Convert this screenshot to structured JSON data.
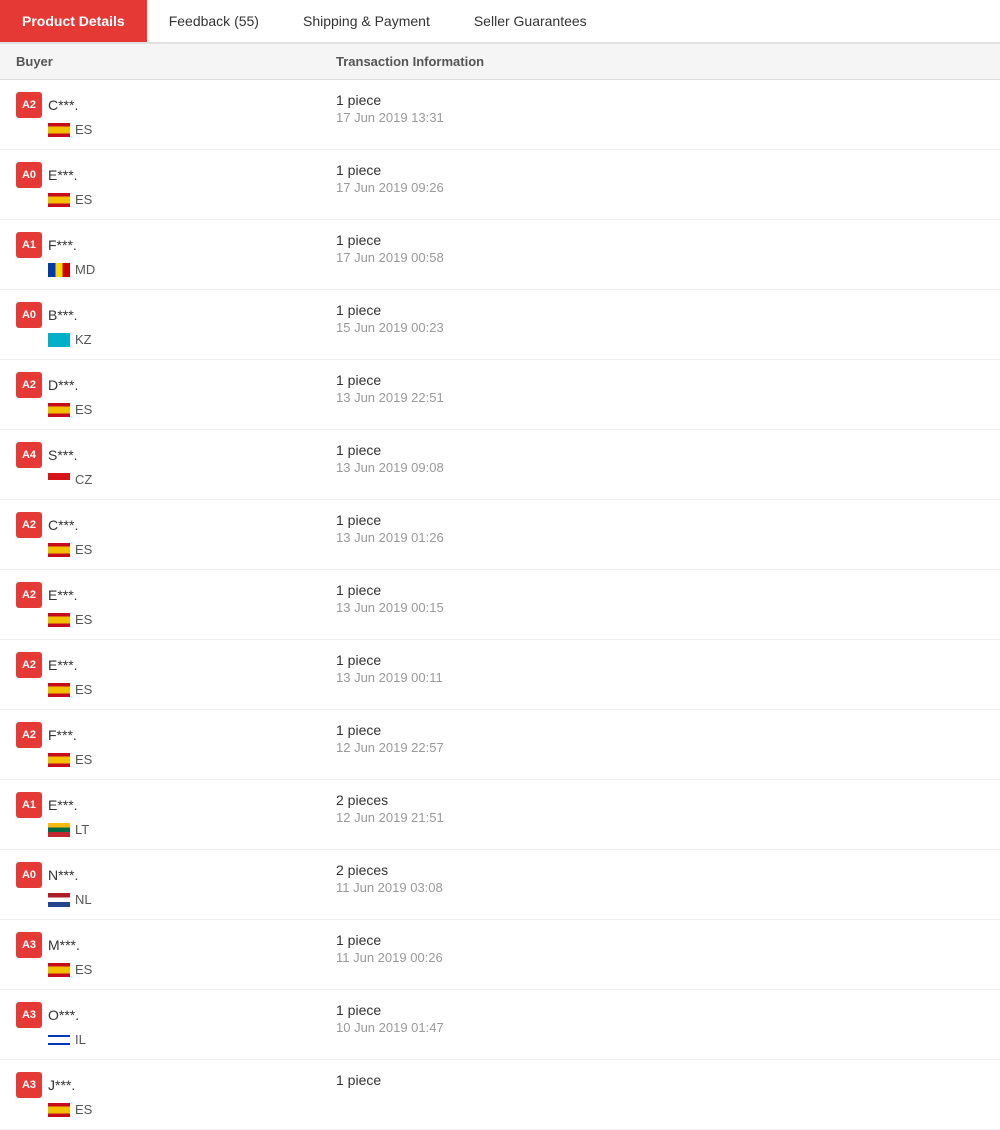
{
  "tabs": [
    {
      "id": "product-details",
      "label": "Product Details",
      "active": true
    },
    {
      "id": "feedback",
      "label": "Feedback (55)",
      "active": false
    },
    {
      "id": "shipping",
      "label": "Shipping & Payment",
      "active": false
    },
    {
      "id": "seller",
      "label": "Seller Guarantees",
      "active": false
    }
  ],
  "table": {
    "col_buyer": "Buyer",
    "col_transaction": "Transaction Information"
  },
  "rows": [
    {
      "avatar_label": "A2",
      "avatar_color": "#e53935",
      "name": "C***.",
      "flag_class": "flag-es",
      "country": "ES",
      "pieces": "1 piece",
      "date": "17 Jun 2019 13:31"
    },
    {
      "avatar_label": "A0",
      "avatar_color": "#e53935",
      "name": "E***.",
      "flag_class": "flag-es",
      "country": "ES",
      "pieces": "1 piece",
      "date": "17 Jun 2019 09:26"
    },
    {
      "avatar_label": "A1",
      "avatar_color": "#e53935",
      "name": "F***.",
      "flag_class": "flag-md",
      "country": "MD",
      "pieces": "1 piece",
      "date": "17 Jun 2019 00:58"
    },
    {
      "avatar_label": "A0",
      "avatar_color": "#e53935",
      "name": "B***.",
      "flag_class": "flag-kz",
      "country": "KZ",
      "pieces": "1 piece",
      "date": "15 Jun 2019 00:23"
    },
    {
      "avatar_label": "A2",
      "avatar_color": "#e53935",
      "name": "D***.",
      "flag_class": "flag-es",
      "country": "ES",
      "pieces": "1 piece",
      "date": "13 Jun 2019 22:51"
    },
    {
      "avatar_label": "A4",
      "avatar_color": "#e53935",
      "name": "S***.",
      "flag_class": "flag-cz",
      "country": "CZ",
      "pieces": "1 piece",
      "date": "13 Jun 2019 09:08"
    },
    {
      "avatar_label": "A2",
      "avatar_color": "#e53935",
      "name": "C***.",
      "flag_class": "flag-es",
      "country": "ES",
      "pieces": "1 piece",
      "date": "13 Jun 2019 01:26"
    },
    {
      "avatar_label": "A2",
      "avatar_color": "#e53935",
      "name": "E***.",
      "flag_class": "flag-es",
      "country": "ES",
      "pieces": "1 piece",
      "date": "13 Jun 2019 00:15"
    },
    {
      "avatar_label": "A2",
      "avatar_color": "#e53935",
      "name": "E***.",
      "flag_class": "flag-es",
      "country": "ES",
      "pieces": "1 piece",
      "date": "13 Jun 2019 00:11"
    },
    {
      "avatar_label": "A2",
      "avatar_color": "#e53935",
      "name": "F***.",
      "flag_class": "flag-es",
      "country": "ES",
      "pieces": "1 piece",
      "date": "12 Jun 2019 22:57"
    },
    {
      "avatar_label": "A1",
      "avatar_color": "#e53935",
      "name": "E***.",
      "flag_class": "flag-lt",
      "country": "LT",
      "pieces": "2 pieces",
      "date": "12 Jun 2019 21:51"
    },
    {
      "avatar_label": "A0",
      "avatar_color": "#e53935",
      "name": "N***.",
      "flag_class": "flag-nl",
      "country": "NL",
      "pieces": "2 pieces",
      "date": "11 Jun 2019 03:08"
    },
    {
      "avatar_label": "A3",
      "avatar_color": "#e53935",
      "name": "M***.",
      "flag_class": "flag-es",
      "country": "ES",
      "pieces": "1 piece",
      "date": "11 Jun 2019 00:26"
    },
    {
      "avatar_label": "A3",
      "avatar_color": "#e53935",
      "name": "O***.",
      "flag_class": "flag-il",
      "country": "IL",
      "pieces": "1 piece",
      "date": "10 Jun 2019 01:47"
    },
    {
      "avatar_label": "A3",
      "avatar_color": "#e53935",
      "name": "J***.",
      "flag_class": "flag-es",
      "country": "ES",
      "pieces": "1 piece",
      "date": ""
    }
  ]
}
